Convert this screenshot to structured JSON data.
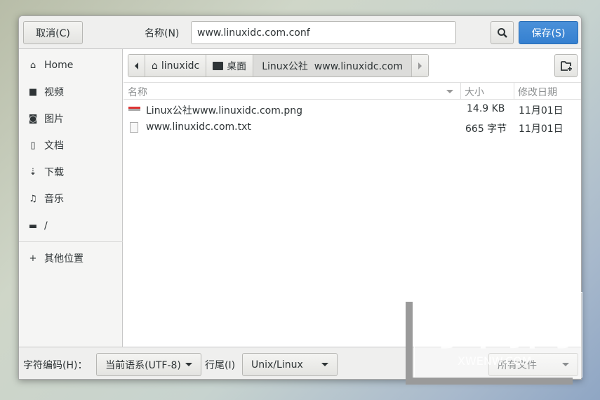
{
  "header": {
    "cancel_label": "取消(C)",
    "name_label": "名称(N)",
    "name_value": "www.linuxidc.com.conf",
    "save_label": "保存(S)",
    "search_icon": "search-icon"
  },
  "sidebar": {
    "items": [
      {
        "label": "Home",
        "icon": "home-icon"
      },
      {
        "label": "视频",
        "icon": "video-icon"
      },
      {
        "label": "图片",
        "icon": "camera-icon"
      },
      {
        "label": "文档",
        "icon": "document-icon"
      },
      {
        "label": "下载",
        "icon": "download-icon"
      },
      {
        "label": "音乐",
        "icon": "music-icon"
      },
      {
        "label": "/",
        "icon": "folder-icon"
      },
      {
        "label": "其他位置",
        "icon": "plus-icon"
      }
    ]
  },
  "breadcrumb": {
    "items": [
      "linuxidc",
      "桌面",
      "Linux公社  www.linuxidc.com"
    ]
  },
  "columns": {
    "name": "名称",
    "size": "大小",
    "modified": "修改日期"
  },
  "files": [
    {
      "name": "Linux公社www.linuxidc.com.png",
      "size": "14.9 KB",
      "modified": "11月01日",
      "icon": "image-file-icon"
    },
    {
      "name": "www.linuxidc.com.txt",
      "size": "665 字节",
      "modified": "11月01日",
      "icon": "text-file-icon"
    }
  ],
  "footer": {
    "encoding_label": "字符编码(H)：",
    "encoding_value": "当前语系(UTF-8)",
    "line_end_label": "行尾(I)",
    "line_end_value": "Unix/Linux",
    "filter_value": "所有文件"
  },
  "watermark": {
    "text": "小闻网",
    "url": "XWENW.COM"
  }
}
